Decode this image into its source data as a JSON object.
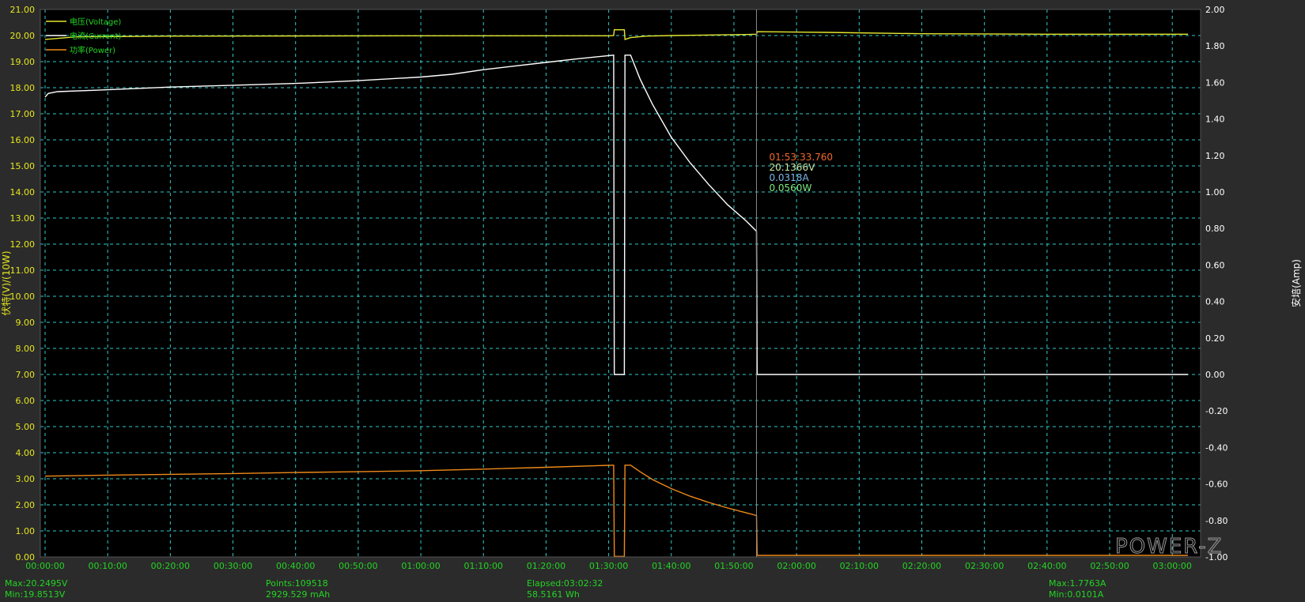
{
  "chart_data": {
    "type": "line",
    "left_axis": {
      "label": "伏特(V)/(10W)",
      "min": 0,
      "max": 21,
      "ticks": [
        "0.00",
        "1.00",
        "2.00",
        "3.00",
        "4.00",
        "5.00",
        "6.00",
        "7.00",
        "8.00",
        "9.00",
        "10.00",
        "11.00",
        "12.00",
        "13.00",
        "14.00",
        "15.00",
        "16.00",
        "17.00",
        "18.00",
        "19.00",
        "20.00",
        "21.00"
      ]
    },
    "right_axis": {
      "label": "安培(Amp)",
      "min": -1,
      "max": 2,
      "ticks": [
        "-1.00",
        "-0.80",
        "-0.60",
        "-0.40",
        "-0.20",
        "0.00",
        "0.20",
        "0.40",
        "0.60",
        "0.80",
        "1.00",
        "1.20",
        "1.40",
        "1.60",
        "1.80",
        "2.00"
      ]
    },
    "x_axis": {
      "min": 0,
      "max": 182.5,
      "unit": "minutes",
      "ticks": [
        "00:00:00",
        "00:10:00",
        "00:20:00",
        "00:30:00",
        "00:40:00",
        "00:50:00",
        "01:00:00",
        "01:10:00",
        "01:20:00",
        "01:30:00",
        "01:40:00",
        "01:50:00",
        "02:00:00",
        "02:10:00",
        "02:20:00",
        "02:30:00",
        "02:40:00",
        "02:50:00",
        "03:00:00"
      ]
    },
    "grid": true,
    "legend_position": "top-left",
    "series": [
      {
        "name": "电压(Voltage)",
        "color": "#e6e62e",
        "axis": "left",
        "points": [
          [
            0,
            19.85
          ],
          [
            5,
            19.95
          ],
          [
            20,
            19.98
          ],
          [
            60,
            19.99
          ],
          [
            90,
            19.99
          ],
          [
            90.8,
            20.0
          ],
          [
            90.9,
            20.22
          ],
          [
            92.5,
            20.22
          ],
          [
            92.6,
            19.85
          ],
          [
            93.5,
            19.92
          ],
          [
            96,
            19.98
          ],
          [
            100,
            20.0
          ],
          [
            112,
            20.04
          ],
          [
            113.6,
            20.05
          ],
          [
            113.7,
            20.15
          ],
          [
            125,
            20.12
          ],
          [
            140,
            20.07
          ],
          [
            160,
            20.05
          ],
          [
            182.5,
            20.05
          ]
        ]
      },
      {
        "name": "电流(Current)",
        "color": "#ffffff",
        "axis": "right",
        "points": [
          [
            0,
            1.52
          ],
          [
            0.5,
            1.54
          ],
          [
            2,
            1.55
          ],
          [
            10,
            1.56
          ],
          [
            20,
            1.575
          ],
          [
            30,
            1.585
          ],
          [
            40,
            1.595
          ],
          [
            50,
            1.61
          ],
          [
            60,
            1.63
          ],
          [
            65,
            1.645
          ],
          [
            70,
            1.67
          ],
          [
            75,
            1.69
          ],
          [
            80,
            1.71
          ],
          [
            85,
            1.73
          ],
          [
            90.8,
            1.75
          ],
          [
            90.9,
            0.0
          ],
          [
            92.5,
            0.0
          ],
          [
            92.6,
            1.75
          ],
          [
            93.5,
            1.75
          ],
          [
            95,
            1.62
          ],
          [
            97,
            1.48
          ],
          [
            100,
            1.3
          ],
          [
            103,
            1.16
          ],
          [
            106,
            1.04
          ],
          [
            109,
            0.93
          ],
          [
            112,
            0.84
          ],
          [
            113.6,
            0.785
          ],
          [
            113.7,
            0.0
          ],
          [
            182.5,
            0.0
          ]
        ]
      },
      {
        "name": "功率(Power)",
        "color": "#f08a1a",
        "axis": "left",
        "points": [
          [
            0,
            3.1
          ],
          [
            10,
            3.14
          ],
          [
            20,
            3.17
          ],
          [
            30,
            3.2
          ],
          [
            40,
            3.24
          ],
          [
            50,
            3.27
          ],
          [
            60,
            3.31
          ],
          [
            70,
            3.37
          ],
          [
            80,
            3.44
          ],
          [
            90.8,
            3.52
          ],
          [
            90.9,
            0.02
          ],
          [
            92.5,
            0.02
          ],
          [
            92.6,
            3.52
          ],
          [
            93.5,
            3.52
          ],
          [
            95,
            3.27
          ],
          [
            97,
            2.97
          ],
          [
            100,
            2.62
          ],
          [
            103,
            2.33
          ],
          [
            106,
            2.09
          ],
          [
            109,
            1.88
          ],
          [
            112,
            1.69
          ],
          [
            113.6,
            1.59
          ],
          [
            113.7,
            0.06
          ],
          [
            182.5,
            0.06
          ]
        ]
      }
    ],
    "cursor": {
      "x": 113.6,
      "time": "01:53:33.760",
      "voltage": "20.1366V",
      "current": "0.0318A",
      "power": "0.0560W"
    }
  },
  "watermark": "POWER-Z",
  "footer": {
    "max_v": "Max:20.2495V",
    "min_v": "Min:19.8513V",
    "points": "Points:109518",
    "mah": "2929.529 mAh",
    "elapsed": "Elapsed:03:02:32",
    "wh": "58.5161 Wh",
    "max_a": "Max:1.7763A",
    "min_a": "Min:0.0101A"
  },
  "colors": {
    "plot_bg": "#000000",
    "frame_bg": "#2b2b2b",
    "grid": "#33c9c9",
    "axis_text": "#e6e61e",
    "x_text": "#22d422",
    "footer_text": "#22d422",
    "readout_time": "#f06a2a",
    "readout_voltage": "#c8e6a0",
    "readout_current": "#7ab8e8",
    "readout_power": "#7ee87e"
  }
}
